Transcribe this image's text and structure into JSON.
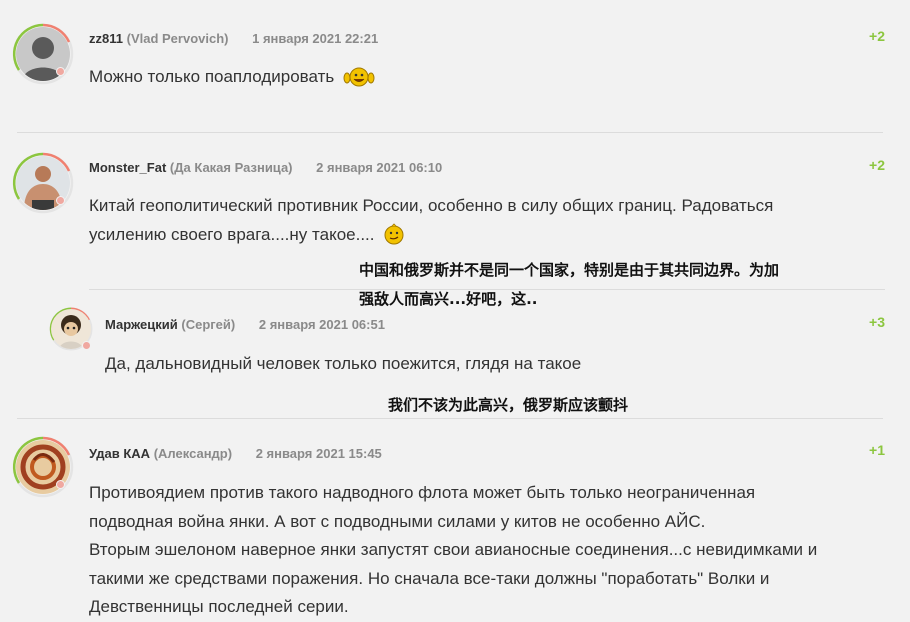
{
  "comments": [
    {
      "nick": "zz811",
      "realname": "(Vlad Pervovich)",
      "date": "1 января 2021 22:21",
      "score": "+2",
      "text": "Можно только поаплодировать",
      "emoji": "applause-smiley-icon"
    },
    {
      "nick": "Monster_Fat",
      "realname": "(Да Какая Разница)",
      "date": "2 января 2021 06:10",
      "score": "+2",
      "text_line1": "Китай геополитический противник России, особенно в силу общих границ. Радоваться",
      "text_line2": "усилению своего врага....ну такое....",
      "emoji": "smirk-smiley-icon"
    },
    {
      "nick": "Маржецкий",
      "realname": "(Сергей)",
      "date": "2 января 2021 06:51",
      "score": "+3",
      "text": "Да, дальновидный человек только поежится, глядя на такое"
    },
    {
      "nick": "Удав КАА",
      "realname": "(Александр)",
      "date": "2 января 2021 15:45",
      "score": "+1",
      "text_line1": "Противоядием против такого надводного флота может быть только неограниченная",
      "text_line2": "подводная война янки. А вот с подводными силами у китов не особенно АЙС.",
      "text_line3": "Вторым эшелоном наверное янки запустят свои авианосные соединения...с невидимками и",
      "text_line4": "такими же средствами поражения. Но сначала все-таки должны \"поработать\" Волки и",
      "text_line5": "Девственницы последней серии."
    }
  ],
  "translations": {
    "t1_line1": "中国和俄罗斯并不是同一个国家，特别是由于其共同边界。为加",
    "t1_line2": "强敌人而高兴...好吧，这..",
    "t2": "我们不该为此高兴，俄罗斯应该颤抖"
  },
  "colors": {
    "background": "#f2f2f2",
    "score": "#8cc63f",
    "meta_gray": "#8a8a8a",
    "avatar_ring": "#f0a8a0"
  }
}
